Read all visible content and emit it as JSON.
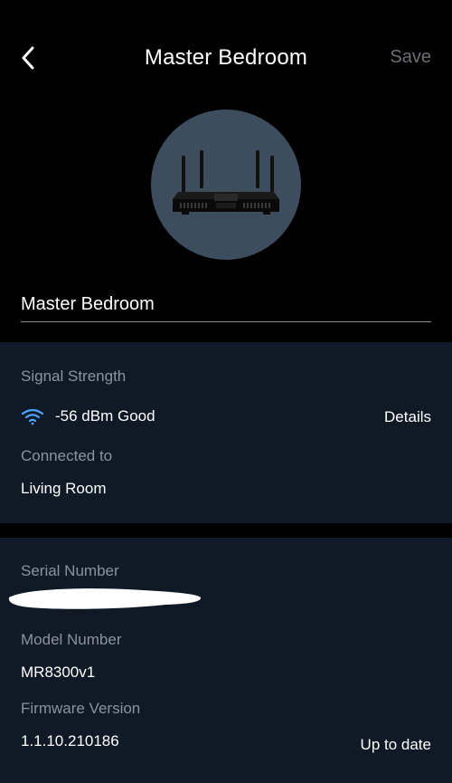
{
  "header": {
    "title": "Master Bedroom",
    "save_label": "Save"
  },
  "device": {
    "name_value": "Master Bedroom",
    "image": "router-icon"
  },
  "connection": {
    "signal_label": "Signal Strength",
    "signal_value": "-56 dBm Good",
    "details_label": "Details",
    "connected_label": "Connected to",
    "connected_value": "Living Room"
  },
  "info": {
    "serial_label": "Serial Number",
    "model_label": "Model Number",
    "model_value": "MR8300v1",
    "firmware_label": "Firmware Version",
    "firmware_value": "1.1.10.210186",
    "firmware_status": "Up to date"
  },
  "colors": {
    "background": "#000000",
    "card": "#0f1a26",
    "avatar": "#3e4d5e",
    "accent_wifi": "#4da3ff",
    "muted_text": "#8b939c",
    "save_disabled": "#6b6e73"
  }
}
